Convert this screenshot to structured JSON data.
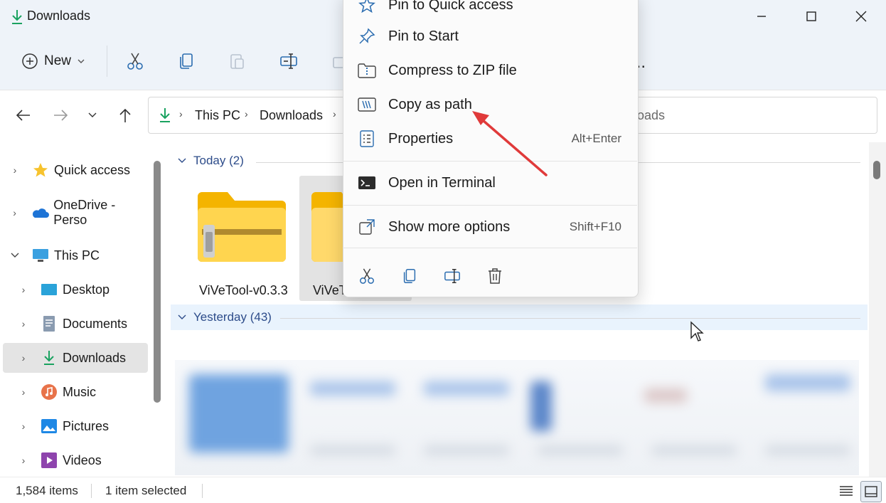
{
  "window": {
    "title": "Downloads",
    "minimize": "minimize",
    "maximize": "maximize",
    "close": "close"
  },
  "toolbar": {
    "new_label": "New",
    "more_label": "..."
  },
  "address": {
    "breadcrumb": [
      "This PC",
      "Downloads"
    ],
    "search_placeholder_visible": "oads"
  },
  "nav": {
    "items": [
      {
        "label": "Quick access",
        "icon": "star-icon"
      },
      {
        "label": "OneDrive - Perso",
        "icon": "onedrive-cloud-icon"
      },
      {
        "label": "This PC",
        "icon": "monitor-icon"
      },
      {
        "label": "Desktop",
        "icon": "desktop-icon"
      },
      {
        "label": "Documents",
        "icon": "documents-icon"
      },
      {
        "label": "Downloads",
        "icon": "download-arrow-icon"
      },
      {
        "label": "Music",
        "icon": "music-icon"
      },
      {
        "label": "Pictures",
        "icon": "pictures-icon"
      },
      {
        "label": "Videos",
        "icon": "videos-icon"
      }
    ]
  },
  "content": {
    "groups": [
      {
        "label": "Today (2)"
      },
      {
        "label": "Yesterday (43)"
      }
    ],
    "files": [
      {
        "name": "ViVeTool-v0.3.3",
        "icon": "zip-folder-icon"
      },
      {
        "name": "ViVeT",
        "icon": "folder-icon"
      }
    ]
  },
  "context_menu": {
    "items": [
      {
        "label": "Pin to Quick access",
        "icon": "star-outline-icon",
        "shortcut": ""
      },
      {
        "label": "Pin to Start",
        "icon": "pin-icon",
        "shortcut": ""
      },
      {
        "label": "Compress to ZIP file",
        "icon": "zip-icon",
        "shortcut": ""
      },
      {
        "label": "Copy as path",
        "icon": "copy-path-icon",
        "shortcut": ""
      },
      {
        "label": "Properties",
        "icon": "properties-icon",
        "shortcut": "Alt+Enter"
      },
      {
        "label": "Open in Terminal",
        "icon": "terminal-icon",
        "shortcut": ""
      },
      {
        "label": "Show more options",
        "icon": "more-options-icon",
        "shortcut": "Shift+F10"
      }
    ],
    "bottom_actions": [
      "cut-icon",
      "copy-icon",
      "rename-icon",
      "delete-icon"
    ]
  },
  "status": {
    "items_count": "1,584 items",
    "selection": "1 item selected"
  },
  "colors": {
    "accent_green": "#1aa260",
    "group_header_blue": "#2d4c8a",
    "arrow_red": "#e03a3a",
    "toolbar_bg": "#eef3f9"
  }
}
